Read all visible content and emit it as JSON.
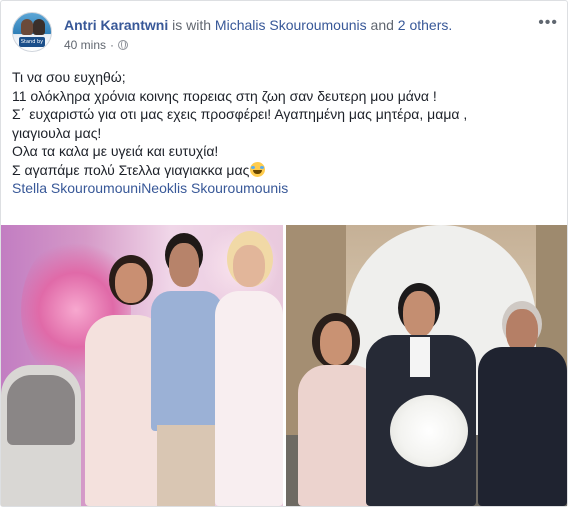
{
  "post": {
    "author": "Antri Karantwni",
    "with_text": "is with",
    "tagged_person": "Michalis Skouroumounis",
    "and_text": "and",
    "others": "2 others.",
    "time": "40 mins",
    "avatar_badge": "Stand by Greece",
    "text_lines": [
      "Τι να σου ευχηθώ;",
      "11 ολόκληρα χρόνια κοινης πορειας στη ζωη σαν δευτερη μου μάνα !",
      "Σ΄ ευχαριστώ για οτι μας εχεις προσφέρει! Αγαπημένη μας μητέρα, μαμα ,",
      "γιαγιουλα μας!",
      "Ολα τα καλα με υγειά και ευτυχία!",
      "Σ αγαπάμε πολύ Στελλα γιαγιακκα μας"
    ],
    "tags": [
      "Stella Skouroumouni",
      "Neoklis Skouroumounis"
    ]
  },
  "icons": {
    "more": "more-options-icon",
    "globe": "globe-icon",
    "emoji": "laughing-tears-emoji-icon"
  },
  "colors": {
    "link": "#385898",
    "text": "#1d2129",
    "meta": "#616770"
  }
}
